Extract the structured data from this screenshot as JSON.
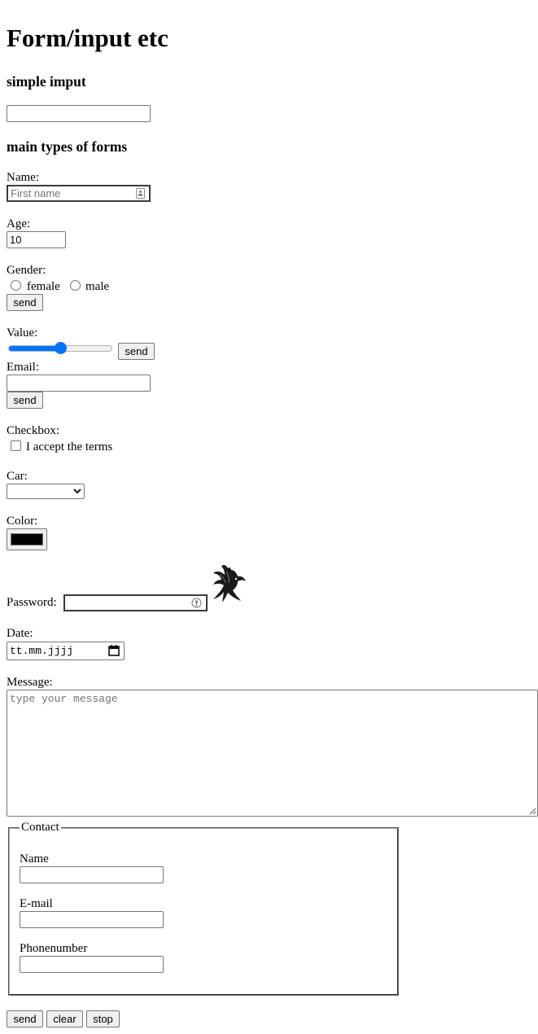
{
  "page": {
    "title": "Form/input etc"
  },
  "sections": {
    "simple_heading": "simple imput",
    "main_heading": "main types of forms"
  },
  "simple_input": {
    "value": ""
  },
  "name_field": {
    "label": "Name:",
    "placeholder": "First name"
  },
  "age_field": {
    "label": "Age:",
    "value": "10"
  },
  "gender": {
    "label": "Gender:",
    "options": [
      "female",
      "male"
    ],
    "send_label": "send"
  },
  "value_slider": {
    "label": "Value:",
    "level": 0.5,
    "send_label": "send"
  },
  "email_field": {
    "label": "Email:",
    "send_label": "send"
  },
  "checkbox": {
    "label": "Checkbox:",
    "option": "I accept the terms"
  },
  "car": {
    "label": "Car:",
    "selected": ""
  },
  "color": {
    "label": "Color:",
    "value": "#000000"
  },
  "password": {
    "label": "Password:"
  },
  "date": {
    "label": "Date:",
    "placeholder": "tt.mm.jjjj"
  },
  "message": {
    "label": "Message:",
    "placeholder": "type your message"
  },
  "contact": {
    "legend": "Contact",
    "name_label": "Name",
    "email_label": "E-mail",
    "phone_label": "Phonenumber"
  },
  "actions": {
    "send_label": "send",
    "clear_label": "clear",
    "stop_label": "stop"
  },
  "icons": {
    "contact_card": "contact-card-icon",
    "key": "key-icon",
    "calendar": "calendar-icon",
    "bird": "bird-image",
    "chevron": "chevron-down-icon"
  },
  "colors": {
    "accent": "#0075ff",
    "border": "#767676",
    "button_bg": "#efefef"
  }
}
